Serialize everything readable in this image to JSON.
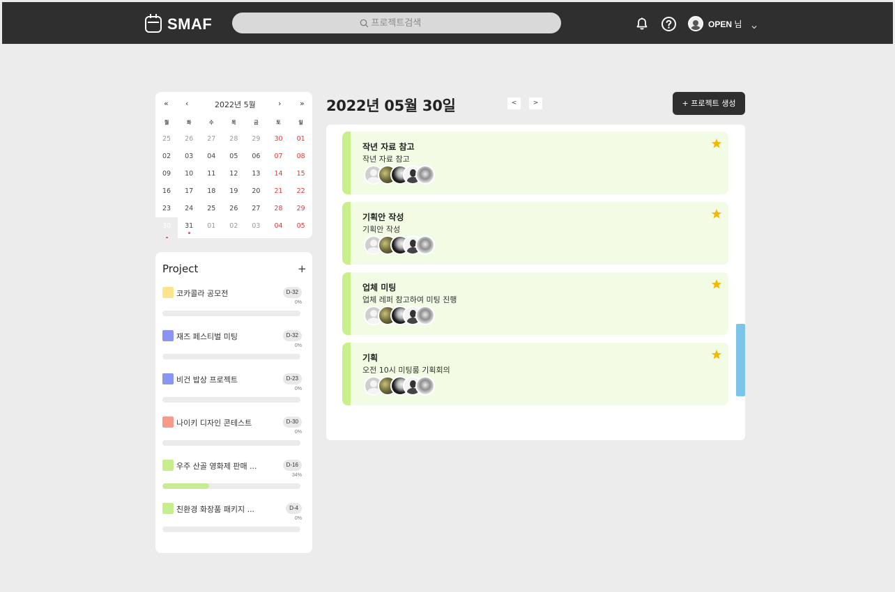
{
  "header": {
    "logo_text": "SMAF",
    "search_placeholder": "프로젝트검색",
    "user_name": "OPEN",
    "user_suffix": "님"
  },
  "calendar": {
    "title": "2022년 5월",
    "prev_year": "«",
    "prev_month": "‹",
    "next_month": "›",
    "next_year": "»",
    "weekdays": [
      "월",
      "화",
      "수",
      "목",
      "금",
      "토",
      "일"
    ],
    "weeks": [
      [
        "25",
        "26",
        "27",
        "28",
        "29",
        "30",
        "01"
      ],
      [
        "02",
        "03",
        "04",
        "05",
        "06",
        "07",
        "08"
      ],
      [
        "09",
        "10",
        "11",
        "12",
        "13",
        "14",
        "15"
      ],
      [
        "16",
        "17",
        "18",
        "19",
        "20",
        "21",
        "22"
      ],
      [
        "23",
        "24",
        "25",
        "26",
        "27",
        "28",
        "29"
      ],
      [
        "30",
        "31",
        "01",
        "02",
        "03",
        "04",
        "05"
      ]
    ],
    "selected": "30"
  },
  "projects": {
    "title": "Project",
    "add_label": "+",
    "items": [
      {
        "name": "코카콜라 공모전",
        "dday": "D-32",
        "pct_label": "0%",
        "progress": 0,
        "color": "#fde48c"
      },
      {
        "name": "재즈 페스티벌 미팅",
        "dday": "D-32",
        "pct_label": "0%",
        "progress": 0,
        "color": "#8c94f2"
      },
      {
        "name": "비건 밥상 프로젝트",
        "dday": "D-23",
        "pct_label": "0%",
        "progress": 0,
        "color": "#8c94f2"
      },
      {
        "name": "나이키 디자인 콘테스트",
        "dday": "D-30",
        "pct_label": "0%",
        "progress": 0,
        "color": "#f59a8c"
      },
      {
        "name": "우주 산골 영화제 판매 ...",
        "dday": "D-16",
        "pct_label": "34%",
        "progress": 0.34,
        "color": "#c6ee8c"
      },
      {
        "name": "친환경 화장품 패키지 ...",
        "dday": "D-4",
        "pct_label": "0%",
        "progress": 0,
        "color": "#c6ee8c"
      }
    ]
  },
  "main": {
    "date_title": "2022년 05월 30일",
    "prev_label": "<",
    "next_label": ">",
    "create_label": "+ 프로젝트 생성",
    "tasks": [
      {
        "title": "작년 자료 참고",
        "desc": "작년 자료 참고",
        "starred": true
      },
      {
        "title": "기획안 작성",
        "desc": "기획안 작성",
        "starred": true
      },
      {
        "title": "업체 미팅",
        "desc": "업체 레퍼 참고하여 미팅 진행",
        "starred": true
      },
      {
        "title": "기획",
        "desc": "오전 10시 미팅룸 기획회의",
        "starred": true
      }
    ]
  },
  "colors": {
    "topbar": "#2f2f2f",
    "task_bg": "#f2fbe3",
    "task_accent": "#c9ef8a",
    "star": "#f5b800",
    "weekend": "#d63b3b",
    "scrollbar": "#7cc4e8"
  }
}
